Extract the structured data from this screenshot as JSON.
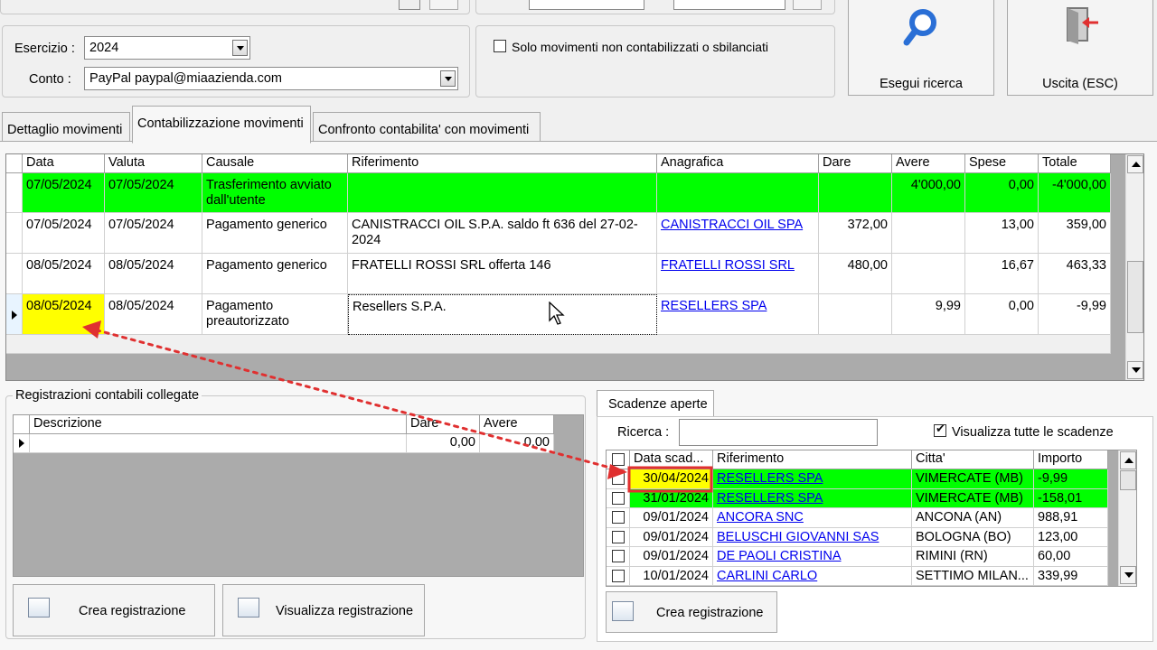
{
  "filters": {
    "esercizio_label": "Esercizio :",
    "esercizio_value": "2024",
    "conto_label": "Conto :",
    "conto_value": "PayPal paypal@miaazienda.com",
    "solo_label": "Solo movimenti non contabilizzati o sbilanciati"
  },
  "buttons": {
    "search": "Esegui ricerca",
    "exit": "Uscita (ESC)",
    "crea": "Crea registrazione",
    "visualizza": "Visualizza registrazione",
    "crea2": "Crea registrazione"
  },
  "tabs": [
    "Dettaglio movimenti",
    "Contabilizzazione movimenti",
    "Confronto contabilita' con movimenti"
  ],
  "movements": {
    "headers": [
      "Data",
      "Valuta",
      "Causale",
      "Riferimento",
      "Anagrafica",
      "Dare",
      "Avere",
      "Spese",
      "Totale"
    ],
    "rows": [
      {
        "data": "07/05/2024",
        "valuta": "07/05/2024",
        "causale": "Trasferimento avviato dall'utente",
        "riferimento": "",
        "anagrafica": "",
        "dare": "",
        "avere": "4'000,00",
        "spese": "0,00",
        "totale": "-4'000,00",
        "color": "#00ff00"
      },
      {
        "data": "07/05/2024",
        "valuta": "07/05/2024",
        "causale": "Pagamento generico",
        "riferimento": "CANISTRACCI OIL S.P.A. saldo ft 636 del 27-02-2024",
        "anagrafica": "CANISTRACCI OIL SPA",
        "dare": "372,00",
        "avere": "",
        "spese": "13,00",
        "totale": "359,00",
        "color": "#ffffff"
      },
      {
        "data": "08/05/2024",
        "valuta": "08/05/2024",
        "causale": "Pagamento generico",
        "riferimento": "FRATELLI ROSSI SRL offerta 146",
        "anagrafica": "FRATELLI ROSSI SRL",
        "dare": "480,00",
        "avere": "",
        "spese": "16,67",
        "totale": "463,33",
        "color": "#ffffff"
      },
      {
        "data": "08/05/2024",
        "valuta": "08/05/2024",
        "causale": "Pagamento preautorizzato",
        "riferimento": "Resellers S.P.A.",
        "anagrafica": "RESELLERS SPA",
        "dare": "",
        "avere": "9,99",
        "spese": "0,00",
        "totale": "-9,99",
        "color": "#ffffff"
      }
    ]
  },
  "registrazioni": {
    "title": "Registrazioni contabili collegate",
    "headers": [
      "Descrizione",
      "Dare",
      "Avere"
    ],
    "dare": "0,00",
    "avere": "0,00"
  },
  "scadenze": {
    "tab": "Scadenze aperte",
    "ricerca_label": "Ricerca :",
    "visualizza_label": "Visualizza tutte le scadenze",
    "headers": [
      "Data scad...",
      "Riferimento",
      "Citta'",
      "Importo"
    ],
    "rows": [
      {
        "data": "30/04/2024",
        "rif": "RESELLERS SPA",
        "citta": "VIMERCATE (MB)",
        "importo": "-9,99",
        "color": "#00ff00"
      },
      {
        "data": "31/01/2024",
        "rif": "RESELLERS SPA",
        "citta": "VIMERCATE (MB)",
        "importo": "-158,01",
        "color": "#00ff00"
      },
      {
        "data": "09/01/2024",
        "rif": "ANCORA SNC",
        "citta": "ANCONA (AN)",
        "importo": "988,91",
        "color": "#ffffff"
      },
      {
        "data": "09/01/2024",
        "rif": "BELUSCHI GIOVANNI SAS",
        "citta": "BOLOGNA (BO)",
        "importo": "123,00",
        "color": "#ffffff"
      },
      {
        "data": "09/01/2024",
        "rif": "DE PAOLI CRISTINA",
        "citta": "RIMINI (RN)",
        "importo": "60,00",
        "color": "#ffffff"
      },
      {
        "data": "10/01/2024",
        "rif": "CARLINI CARLO",
        "citta": "SETTIMO MILAN...",
        "importo": "339,99",
        "color": "#ffffff"
      }
    ]
  },
  "colors": {
    "highlight": "#ffff00",
    "accent_red": "#e03030",
    "link": "#0000ee"
  }
}
